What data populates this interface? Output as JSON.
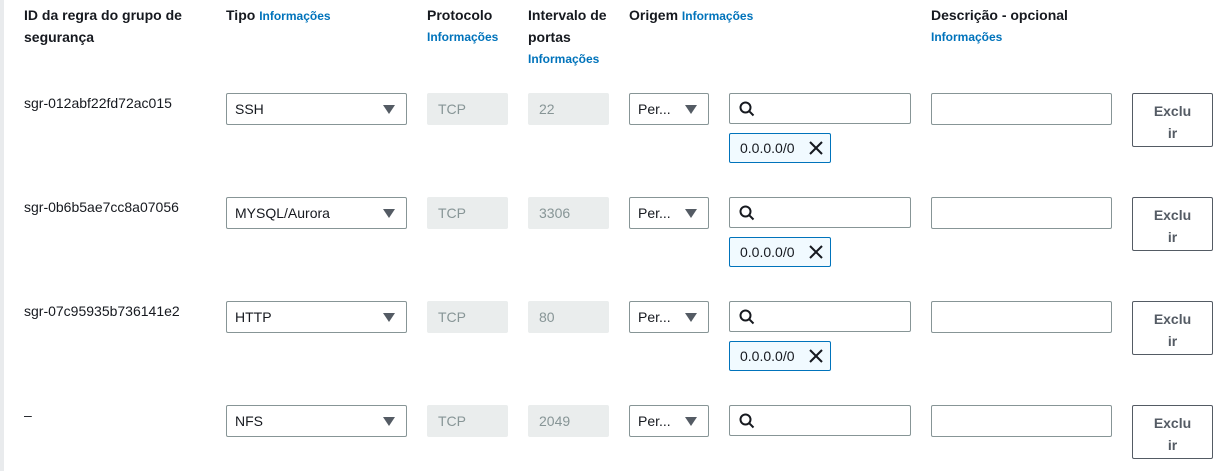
{
  "headers": {
    "rule_id": "ID da regra do grupo de segurança",
    "type": "Tipo",
    "protocol": "Protocolo",
    "port_range": "Intervalo de portas",
    "source": "Origem",
    "description": "Descrição - opcional",
    "info_link": "Informações"
  },
  "rows": [
    {
      "rule_id": "sgr-012abf22fd72ac015",
      "type": "SSH",
      "protocol": "TCP",
      "port": "22",
      "source_mode": "Per...",
      "cidr": "0.0.0.0/0",
      "delete_label": "Excluir"
    },
    {
      "rule_id": "sgr-0b6b5ae7cc8a07056",
      "type": "MYSQL/Aurora",
      "protocol": "TCP",
      "port": "3306",
      "source_mode": "Per...",
      "cidr": "0.0.0.0/0",
      "delete_label": "Excluir"
    },
    {
      "rule_id": "sgr-07c95935b736141e2",
      "type": "HTTP",
      "protocol": "TCP",
      "port": "80",
      "source_mode": "Per...",
      "cidr": "0.0.0.0/0",
      "delete_label": "Excluir"
    },
    {
      "rule_id": "–",
      "type": "NFS",
      "protocol": "TCP",
      "port": "2049",
      "source_mode": "Per...",
      "delete_label": "Excluir"
    }
  ],
  "icons": {
    "search": "search-icon",
    "remove_token": "close-icon",
    "dropdown": "caret-down-icon"
  },
  "colors": {
    "link": "#0073bb",
    "token_border": "#0073bb",
    "token_bg": "#f1faff",
    "border": "#879596"
  }
}
